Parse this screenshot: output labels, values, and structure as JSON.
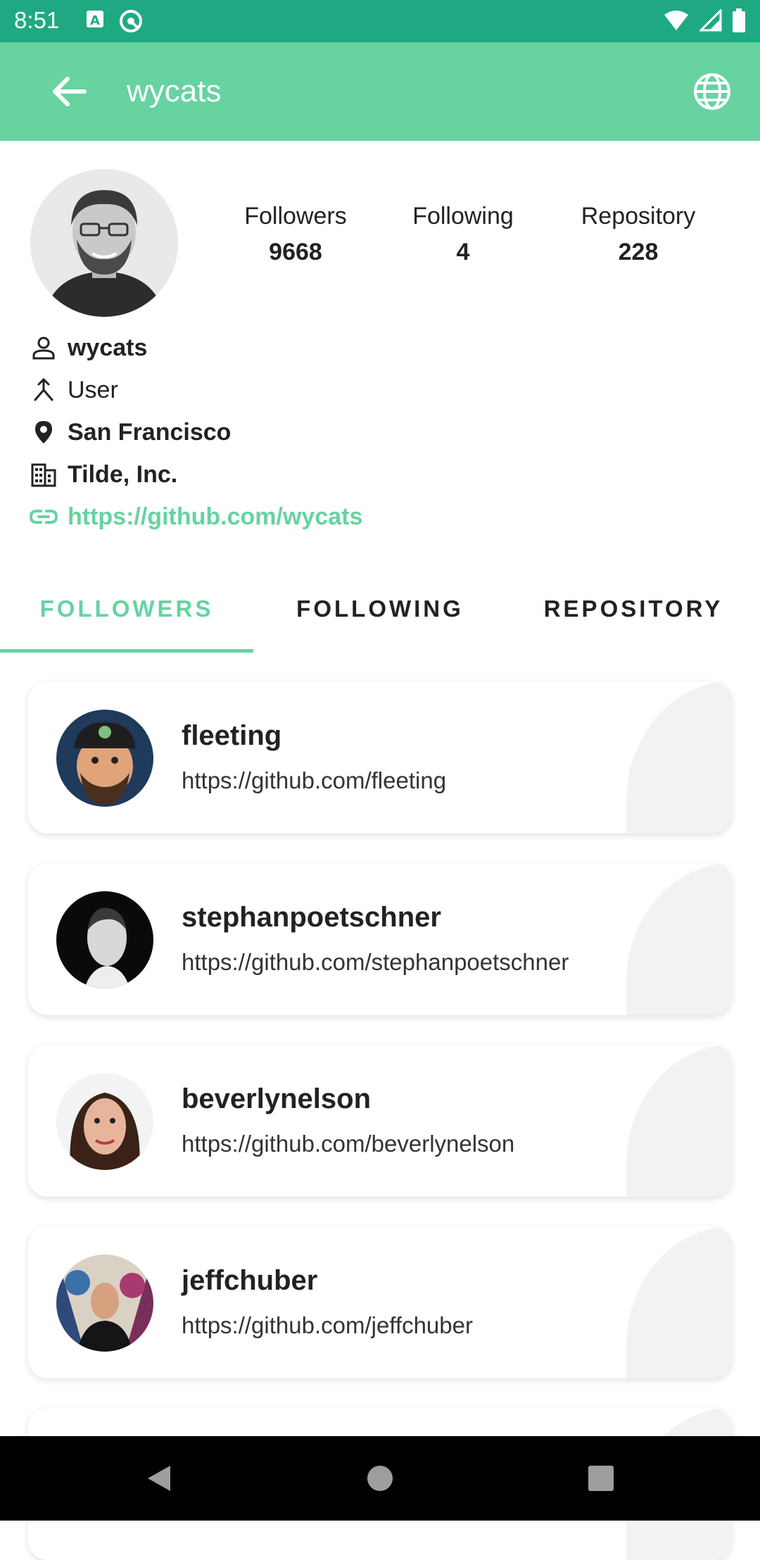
{
  "status_bar": {
    "time": "8:51"
  },
  "app_bar": {
    "title": "wycats"
  },
  "stats": [
    {
      "label": "Followers",
      "value": "9668"
    },
    {
      "label": "Following",
      "value": "4"
    },
    {
      "label": "Repository",
      "value": "228"
    }
  ],
  "profile": {
    "login": "wycats",
    "type": "User",
    "location": "San Francisco",
    "company": "Tilde, Inc.",
    "url": "https://github.com/wycats"
  },
  "tabs": [
    "FOLLOWERS",
    "FOLLOWING",
    "REPOSITORY"
  ],
  "followers": [
    {
      "name": "fleeting",
      "url": "https://github.com/fleeting"
    },
    {
      "name": "stephanpoetschner",
      "url": "https://github.com/stephanpoetschner"
    },
    {
      "name": "beverlynelson",
      "url": "https://github.com/beverlynelson"
    },
    {
      "name": "jeffchuber",
      "url": "https://github.com/jeffchuber"
    }
  ],
  "colors": {
    "accent": "#66d3a1",
    "status_bar": "#1fa982"
  }
}
